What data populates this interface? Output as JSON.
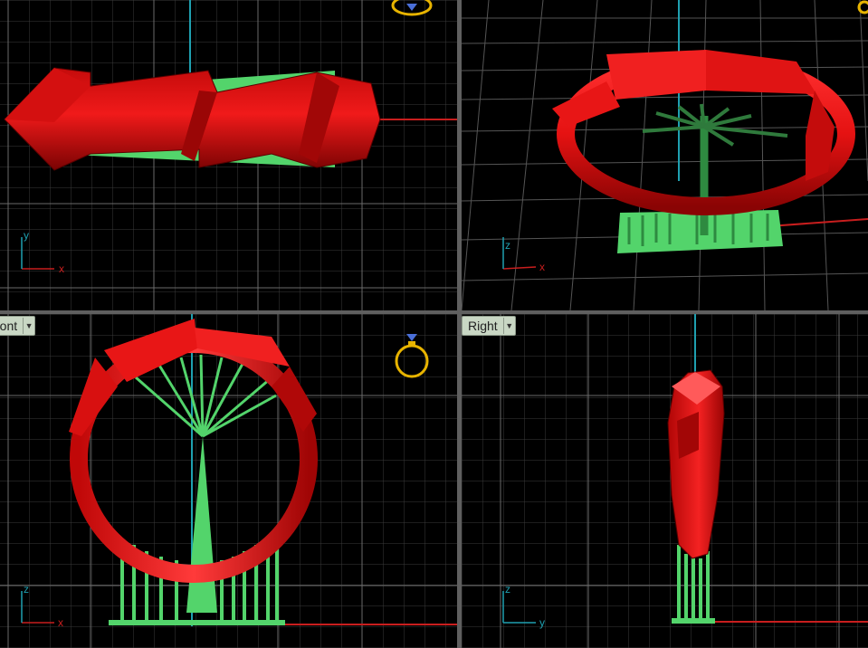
{
  "viewports": {
    "front": {
      "label": "ront",
      "dropdown_glyph": "▼"
    },
    "right": {
      "label": "Right",
      "dropdown_glyph": "▼"
    }
  },
  "axis_labels": {
    "top": {
      "x": "x",
      "y": "y"
    },
    "persp": {
      "x": "x",
      "y": "z"
    },
    "front": {
      "x": "x",
      "y": "z"
    },
    "right": {
      "x": "y",
      "y": "z"
    }
  },
  "colors": {
    "background": "#000000",
    "grid": "#3a3a3a",
    "grid_major": "#6a6a6a",
    "model_ring": "#e31010",
    "model_supports": "#53d46b",
    "axis_x": "#c81e1e",
    "axis_y": "#1fa0b0",
    "gizmo": "#e8b400"
  },
  "icons": {
    "gizmo": "ring-gizmo-icon",
    "dropdown": "chevron-down-icon"
  }
}
